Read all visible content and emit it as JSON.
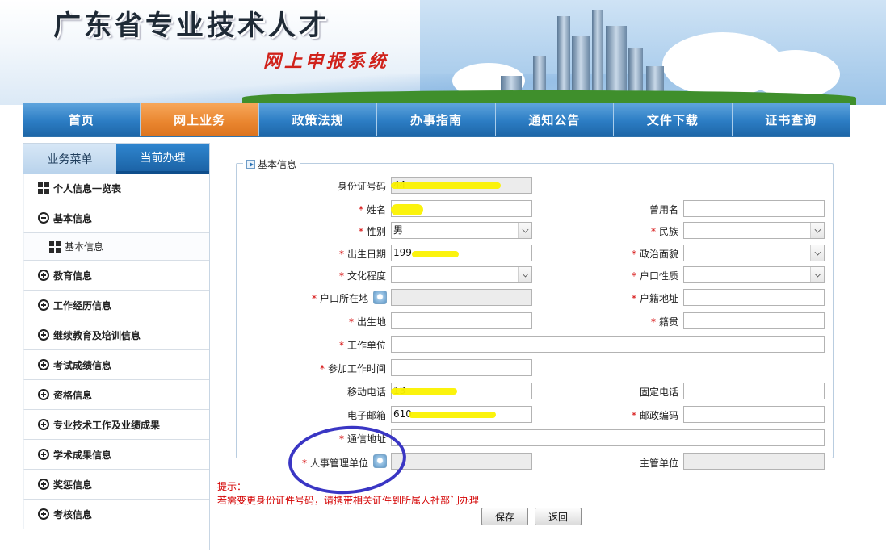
{
  "header": {
    "title": "广东省专业技术人才",
    "subtitle": "网上申报系统"
  },
  "nav": {
    "items": [
      {
        "label": "首页",
        "active": false
      },
      {
        "label": "网上业务",
        "active": true
      },
      {
        "label": "政策法规",
        "active": false
      },
      {
        "label": "办事指南",
        "active": false
      },
      {
        "label": "通知公告",
        "active": false
      },
      {
        "label": "文件下载",
        "active": false
      },
      {
        "label": "证书查询",
        "active": false
      }
    ]
  },
  "sidebar": {
    "tabs": {
      "menu": "业务菜单",
      "current": "当前办理"
    },
    "items": [
      {
        "label": "个人信息一览表",
        "icon": "grid-icon"
      },
      {
        "label": "基本信息",
        "icon": "minus-circle-icon"
      },
      {
        "label": "基本信息",
        "icon": "grid-icon"
      },
      {
        "label": "教育信息",
        "icon": "plus-circle-icon"
      },
      {
        "label": "工作经历信息",
        "icon": "plus-circle-icon"
      },
      {
        "label": "继续教育及培训信息",
        "icon": "plus-circle-icon"
      },
      {
        "label": "考试成绩信息",
        "icon": "plus-circle-icon"
      },
      {
        "label": "资格信息",
        "icon": "plus-circle-icon"
      },
      {
        "label": "专业技术工作及业绩成果",
        "icon": "plus-circle-icon"
      },
      {
        "label": "学术成果信息",
        "icon": "plus-circle-icon"
      },
      {
        "label": "奖惩信息",
        "icon": "plus-circle-icon"
      },
      {
        "label": "考核信息",
        "icon": "plus-circle-icon"
      }
    ]
  },
  "form": {
    "legend": "基本信息",
    "required_mark": "*",
    "labels": {
      "id_number": "身份证号码",
      "name": "姓名",
      "used_name": "曾用名",
      "gender": "性别",
      "ethnicity": "民族",
      "birth_date": "出生日期",
      "political_status": "政治面貌",
      "education": "文化程度",
      "hukou_type": "户口性质",
      "hukou_location": "户口所在地",
      "hukou_address": "户籍地址",
      "birthplace": "出生地",
      "native_place": "籍贯",
      "work_unit": "工作单位",
      "work_start_date": "参加工作时间",
      "mobile": "移动电话",
      "landline": "固定电话",
      "email": "电子邮箱",
      "postal_code": "邮政编码",
      "address": "通信地址",
      "hr_unit": "人事管理单位",
      "supervisor_unit": "主管单位"
    },
    "values": {
      "id_number": "44",
      "name": "",
      "used_name": "",
      "gender": "男",
      "ethnicity": "",
      "birth_date": "199",
      "political_status": "",
      "education": "",
      "hukou_type": "",
      "hukou_location": "",
      "hukou_address": "",
      "birthplace": "",
      "native_place": "",
      "work_unit": "",
      "work_start_date": "",
      "mobile": "13",
      "landline": "",
      "email": "610",
      "postal_code": "",
      "address": "",
      "hr_unit": "",
      "supervisor_unit": ""
    }
  },
  "hint": {
    "title": "提示：",
    "text": "若需变更身份证件号码，请携带相关证件到所属人社部门办理"
  },
  "buttons": {
    "save": "保存",
    "back": "返回"
  },
  "colors": {
    "nav_blue": "#2c7dc4",
    "nav_active_orange": "#e9852e",
    "required_red": "#d40000",
    "redaction_yellow": "#fbf200",
    "annotation_blue": "#3a36c4"
  }
}
